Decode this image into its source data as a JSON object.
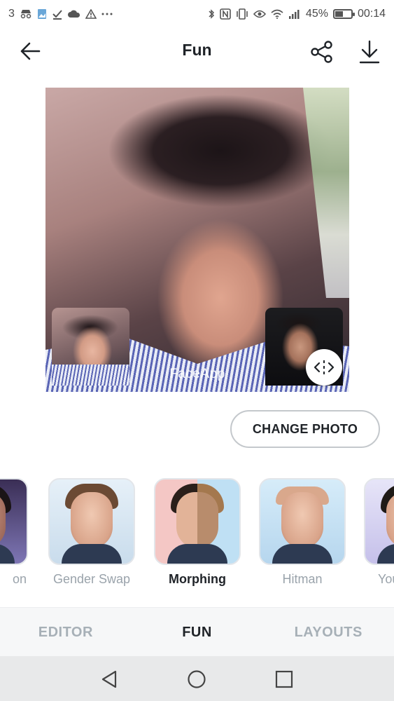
{
  "status_bar": {
    "left_text": "3",
    "left_icons": [
      "incognito-icon",
      "photo-icon",
      "check-download-icon",
      "cloud-icon",
      "warning-icon",
      "more-icon"
    ],
    "right_icons": [
      "bluetooth-icon",
      "nfc-icon",
      "vibrate-icon",
      "eye-icon",
      "wifi-icon",
      "signal-icon",
      "battery-icon"
    ],
    "battery_percent": "45%",
    "battery_level": 0.45,
    "time": "00:14"
  },
  "app_bar": {
    "title": "Fun",
    "back_icon": "back-arrow-icon",
    "share_icon": "share-icon",
    "download_icon": "download-icon"
  },
  "photo": {
    "watermark": "FaceApp",
    "compare_icon": "compare-handle-icon"
  },
  "change_photo_label": "CHANGE PHOTO",
  "filters": [
    {
      "label": "on",
      "selected": false
    },
    {
      "label": "Gender Swap",
      "selected": false
    },
    {
      "label": "Morphing",
      "selected": true
    },
    {
      "label": "Hitman",
      "selected": false
    },
    {
      "label": "You",
      "selected": false
    }
  ],
  "tabs": [
    {
      "label": "EDITOR",
      "active": false
    },
    {
      "label": "FUN",
      "active": true
    },
    {
      "label": "LAYOUTS",
      "active": false
    }
  ],
  "nav": {
    "back_icon": "nav-back-icon",
    "home_icon": "nav-home-icon",
    "recents_icon": "nav-recents-icon"
  },
  "colors": {
    "text_dark": "#1f2328",
    "text_muted": "#a7b0b7",
    "button_border": "#c4c8cc",
    "tab_bar_bg": "#f6f7f8",
    "nav_bar_bg": "#e8e9ea"
  }
}
